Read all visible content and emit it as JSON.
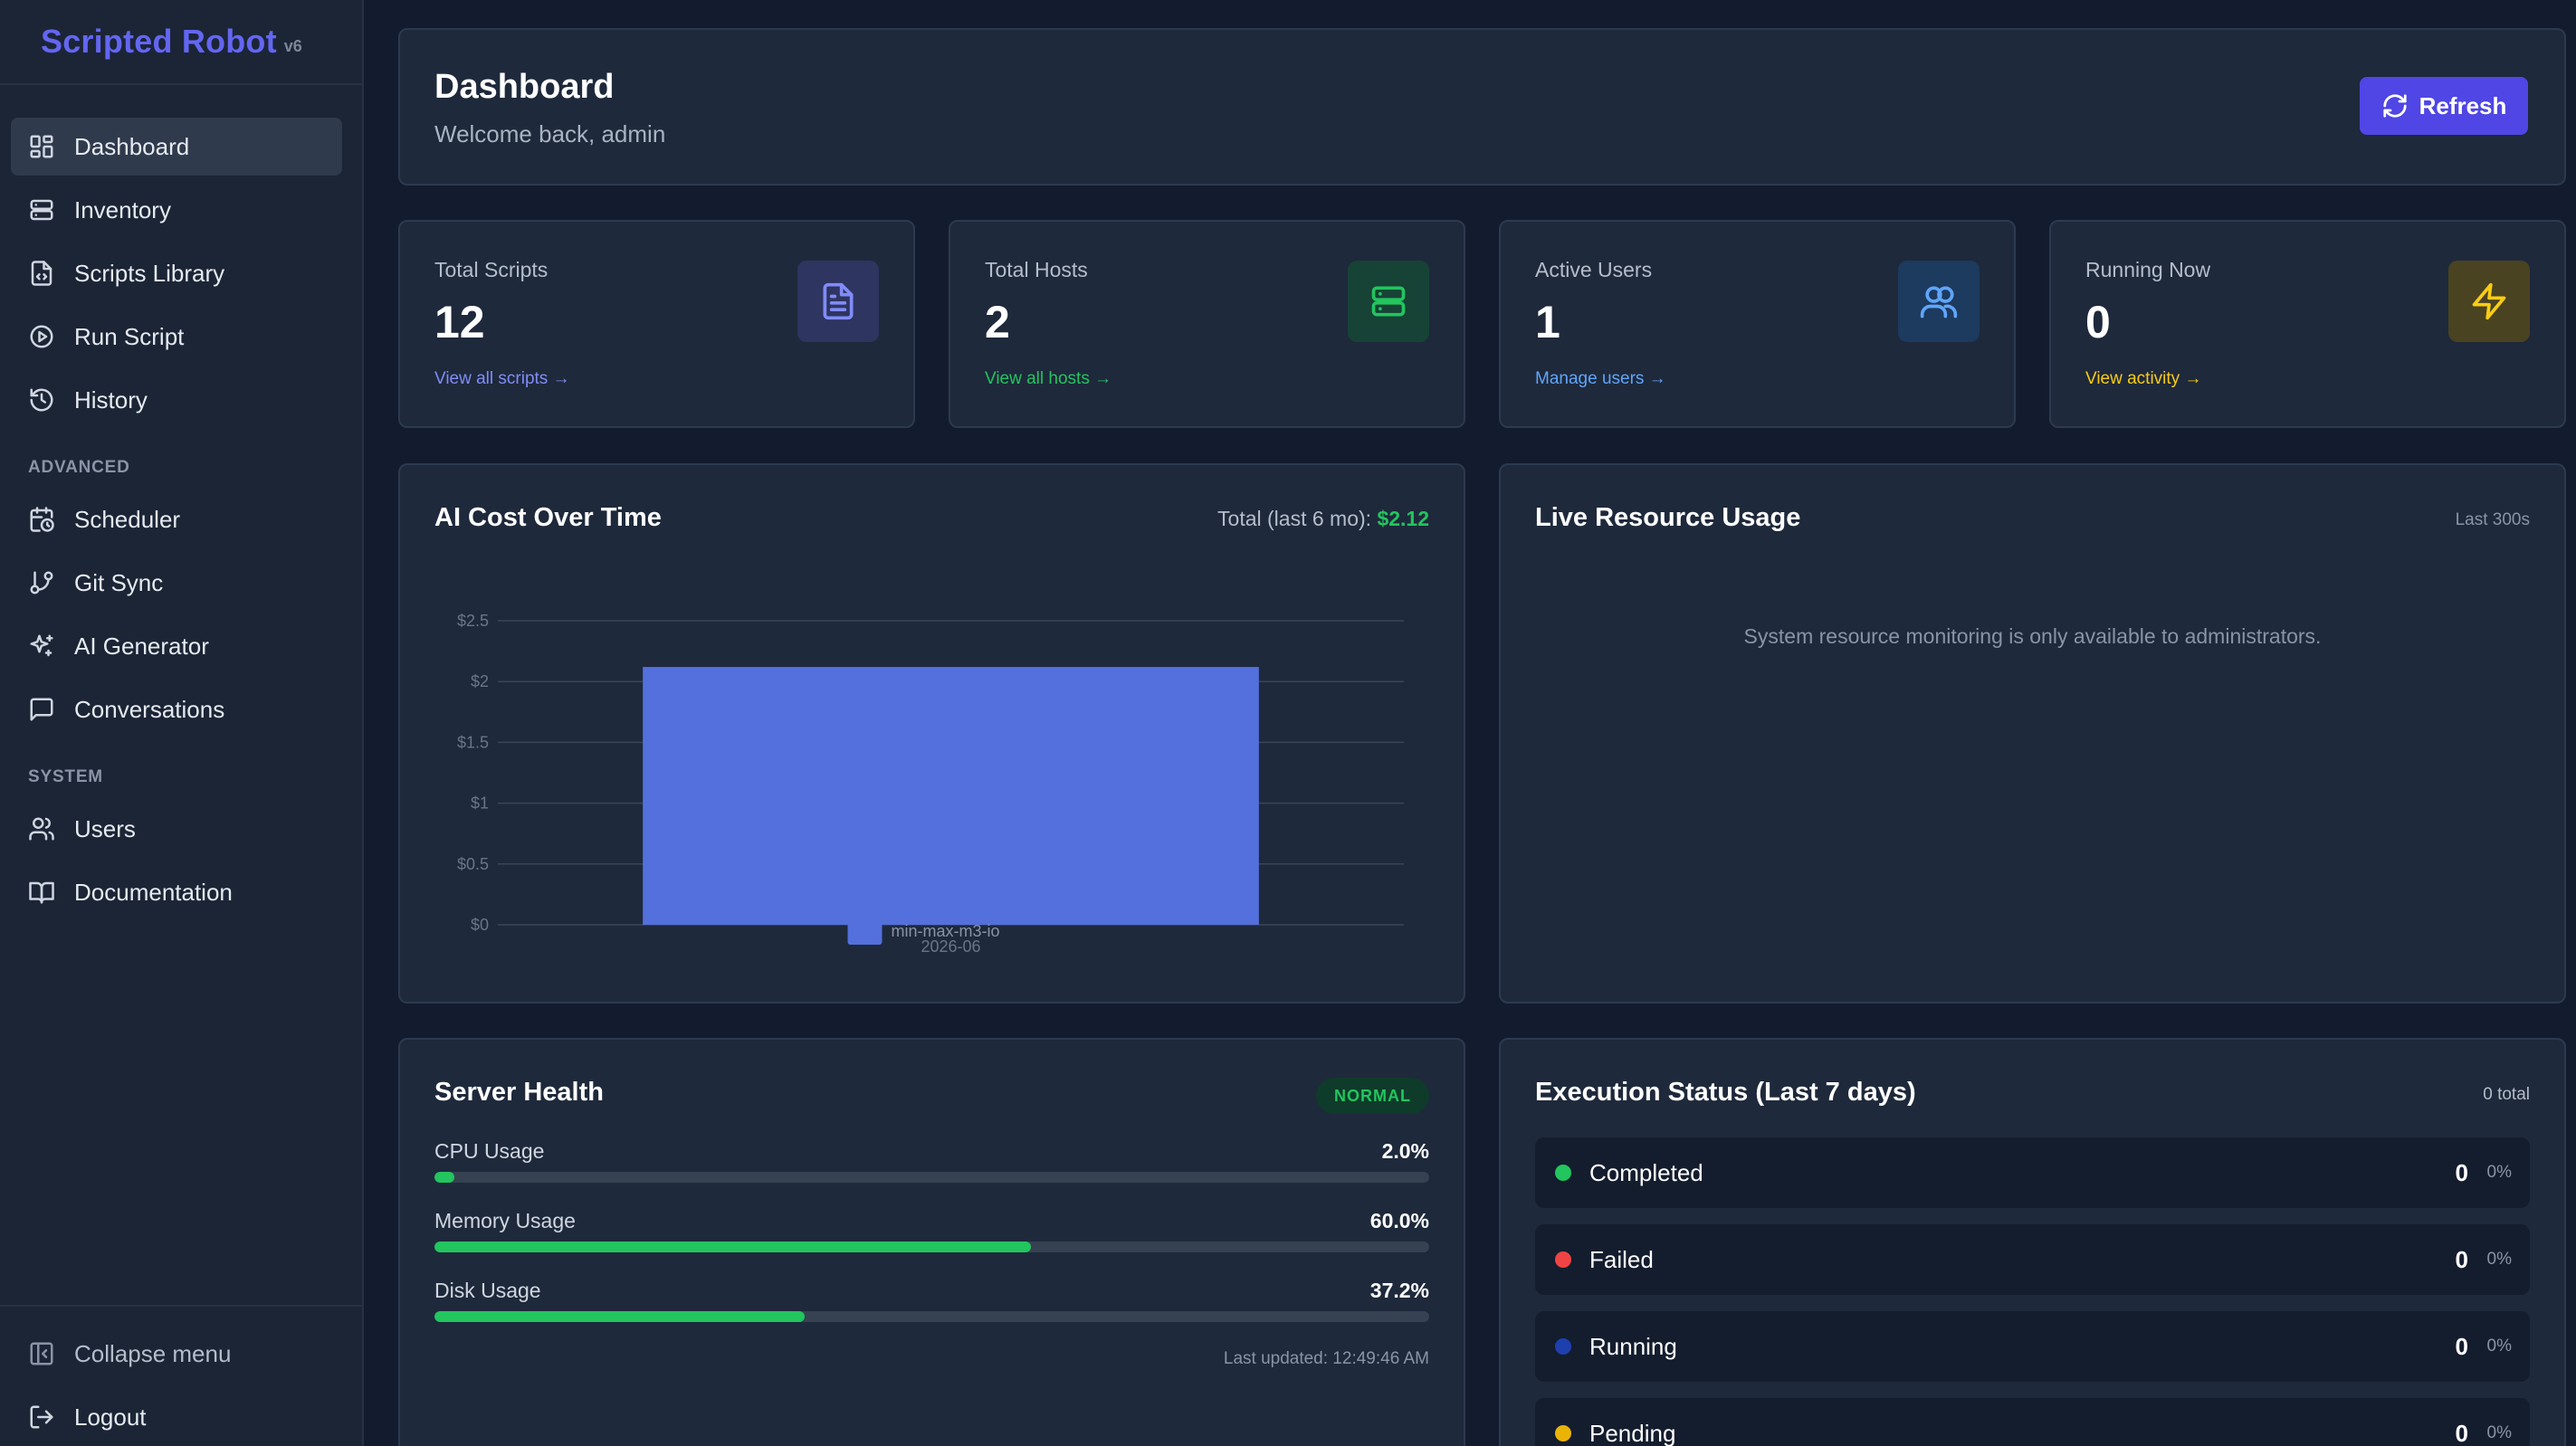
{
  "app": {
    "name": "Scripted Robot",
    "version": "v6"
  },
  "sidebar": {
    "primary": [
      {
        "label": "Dashboard",
        "icon": "dashboard-icon",
        "active": true
      },
      {
        "label": "Inventory",
        "icon": "server-icon"
      },
      {
        "label": "Scripts Library",
        "icon": "file-code-icon"
      },
      {
        "label": "Run Script",
        "icon": "play-circle-icon"
      },
      {
        "label": "History",
        "icon": "history-icon"
      }
    ],
    "advanced_heading": "ADVANCED",
    "advanced": [
      {
        "label": "Scheduler",
        "icon": "calendar-clock-icon"
      },
      {
        "label": "Git Sync",
        "icon": "git-branch-icon"
      },
      {
        "label": "AI Generator",
        "icon": "sparkles-icon"
      },
      {
        "label": "Conversations",
        "icon": "message-square-icon"
      }
    ],
    "system_heading": "SYSTEM",
    "system": [
      {
        "label": "Users",
        "icon": "users-icon"
      },
      {
        "label": "Documentation",
        "icon": "book-icon"
      }
    ],
    "collapse_label": "Collapse menu",
    "logout_label": "Logout"
  },
  "header": {
    "title": "Dashboard",
    "subtitle": "Welcome back, admin",
    "refresh_label": "Refresh"
  },
  "stats": [
    {
      "label": "Total Scripts",
      "value": "12",
      "link": "View all scripts →",
      "icon": "file-text-icon",
      "color": "#818cf8",
      "bg": "#2e3561"
    },
    {
      "label": "Total Hosts",
      "value": "2",
      "link": "View all hosts →",
      "icon": "server-icon",
      "color": "#22c55e",
      "bg": "#174236"
    },
    {
      "label": "Active Users",
      "value": "1",
      "link": "Manage users →",
      "icon": "users-icon",
      "color": "#60a5fa",
      "bg": "#1d3a5f"
    },
    {
      "label": "Running Now",
      "value": "0",
      "link": "View activity →",
      "icon": "zap-icon",
      "color": "#facc15",
      "bg": "#4a4322"
    }
  ],
  "cost_panel": {
    "title": "AI Cost Over Time",
    "total_label": "Total (last 6 mo):",
    "total_value": "$2.12"
  },
  "chart_data": {
    "type": "bar",
    "title": "AI Cost Over Time",
    "categories": [
      "2026-06"
    ],
    "series": [
      {
        "name": "min-max-m3-io",
        "values": [
          2.12
        ],
        "color": "#5470dc"
      }
    ],
    "ylim": [
      0,
      2.5
    ],
    "yticks": [
      "$0",
      "$0.5",
      "$1",
      "$1.5",
      "$2",
      "$2.5"
    ],
    "ytick_values": [
      0,
      0.5,
      1,
      1.5,
      2,
      2.5
    ],
    "grid": true,
    "legend_position": "bottom"
  },
  "live_panel": {
    "title": "Live Resource Usage",
    "range": "Last 300s",
    "message": "System resource monitoring is only available to administrators."
  },
  "health_panel": {
    "title": "Server Health",
    "badge": "NORMAL",
    "metrics": [
      {
        "label": "CPU Usage",
        "value": "2.0%",
        "percent": 2.0
      },
      {
        "label": "Memory Usage",
        "value": "60.0%",
        "percent": 60.0
      },
      {
        "label": "Disk Usage",
        "value": "37.2%",
        "percent": 37.2
      }
    ],
    "updated": "Last updated: 12:49:46 AM"
  },
  "exec_panel": {
    "title": "Execution Status (Last 7 days)",
    "total": "0 total",
    "rows": [
      {
        "label": "Completed",
        "count": "0",
        "pct": "0%",
        "color": "#22c55e"
      },
      {
        "label": "Failed",
        "count": "0",
        "pct": "0%",
        "color": "#ef4444"
      },
      {
        "label": "Running",
        "count": "0",
        "pct": "0%",
        "color": "#1e40af"
      },
      {
        "label": "Pending",
        "count": "0",
        "pct": "0%",
        "color": "#eab308"
      }
    ]
  }
}
